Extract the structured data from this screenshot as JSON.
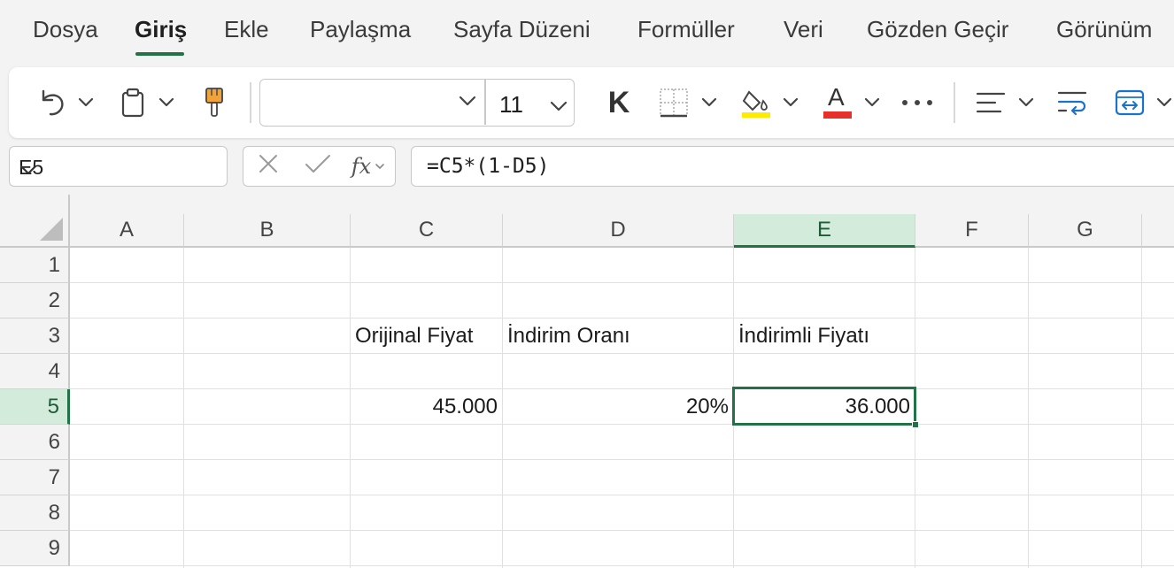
{
  "menu": {
    "tabs": [
      "Dosya",
      "Giriş",
      "Ekle",
      "Paylaşma",
      "Sayfa Düzeni",
      "Formüller",
      "Veri",
      "Gözden Geçir",
      "Görünüm"
    ],
    "active_tab": "Giriş"
  },
  "ribbon": {
    "font_name": "",
    "font_size": "11",
    "bold_label": "K",
    "font_color_letter": "A",
    "fill_color": "#ffeb00",
    "font_color": "#e8302a",
    "icons": [
      "undo-icon",
      "clipboard-icon",
      "format-painter-icon",
      "bold-icon",
      "borders-icon",
      "fill-color-icon",
      "font-color-icon",
      "more-icon",
      "align-icon",
      "wrap-text-icon",
      "merge-icon"
    ]
  },
  "formula_bar": {
    "name_box": "E5",
    "fx_label": "fx",
    "formula": "=C5*(1-D5)"
  },
  "sheet": {
    "columns": [
      "A",
      "B",
      "C",
      "D",
      "E",
      "F",
      "G"
    ],
    "rows": [
      "1",
      "2",
      "3",
      "4",
      "5",
      "6",
      "7",
      "8",
      "9"
    ],
    "selected_column": "E",
    "selected_row": "5",
    "cells": {
      "C3": "Orijinal Fiyat",
      "D3": "İndirim Oranı",
      "E3": "İndirimli Fiyatı",
      "C5": "45.000",
      "D5": "20%",
      "E5": "36.000"
    },
    "accent_color": "#217346"
  }
}
